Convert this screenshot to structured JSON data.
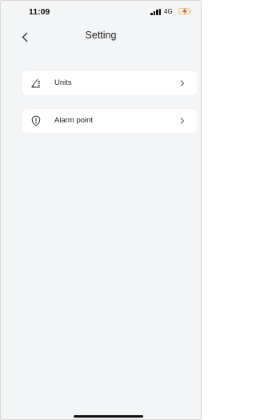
{
  "status_bar": {
    "time": "11:09",
    "network": "4G",
    "battery_charging": true
  },
  "nav": {
    "title": "Setting",
    "back_icon": "chevron-left-icon"
  },
  "menu": {
    "items": [
      {
        "label": "Units",
        "icon": "units-ruler-icon"
      },
      {
        "label": "Alarm point",
        "icon": "alarm-shield-icon"
      }
    ]
  },
  "colors": {
    "background": "#f4f5f7",
    "card": "#ffffff",
    "text": "#222222"
  }
}
